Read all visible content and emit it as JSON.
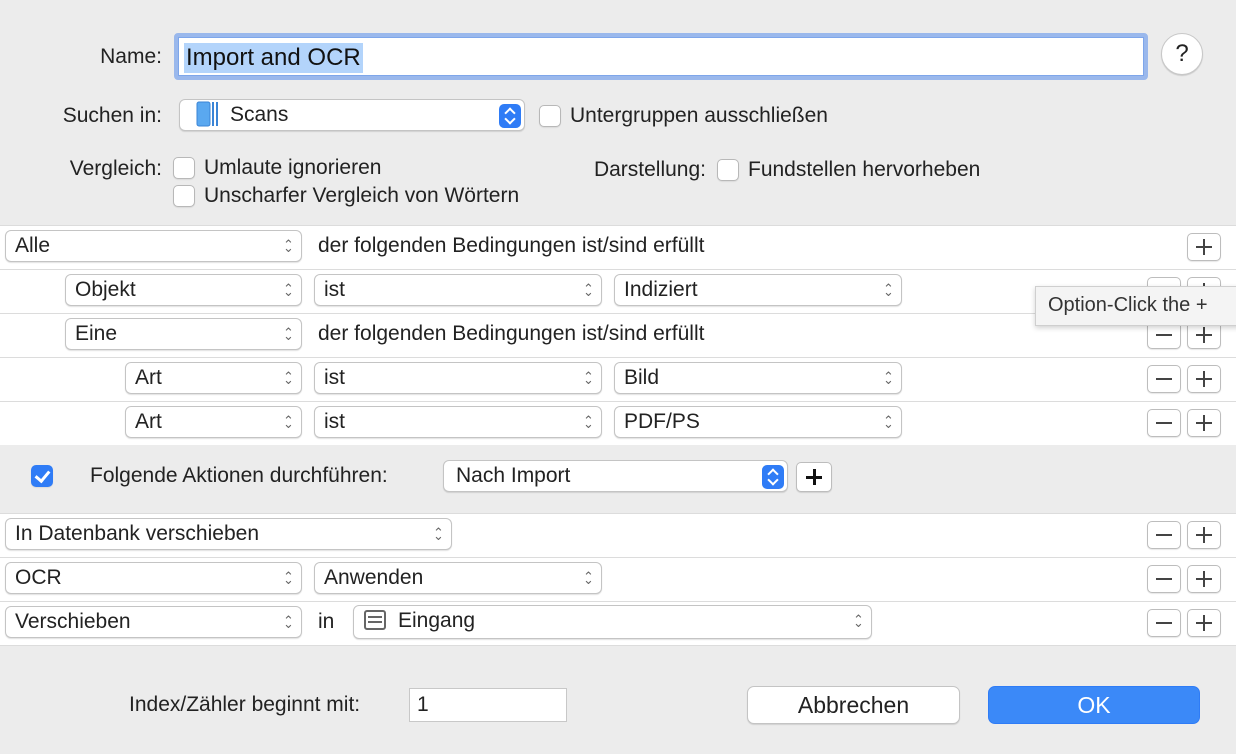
{
  "name": {
    "label": "Name:",
    "value": "Import and OCR",
    "help": "?"
  },
  "search_in": {
    "label": "Suchen in:",
    "value": "Scans",
    "exclude_label": "Untergruppen ausschließen",
    "exclude_checked": false
  },
  "compare": {
    "label": "Vergleich:",
    "option1": "Umlaute ignorieren",
    "option2": "Unscharfer Vergleich von Wörtern"
  },
  "display": {
    "label": "Darstellung:",
    "option": "Fundstellen hervorheben"
  },
  "conditions": {
    "row0": {
      "scope": "Alle",
      "text": "der folgenden Bedingungen ist/sind erfüllt"
    },
    "row1": {
      "field": "Objekt",
      "op": "ist",
      "value": "Indiziert"
    },
    "row2": {
      "scope": "Eine",
      "text": "der folgenden Bedingungen ist/sind erfüllt"
    },
    "row3": {
      "field": "Art",
      "op": "ist",
      "value": "Bild"
    },
    "row4": {
      "field": "Art",
      "op": "ist",
      "value": "PDF/PS"
    }
  },
  "tooltip": "Option-Click the +",
  "actions": {
    "enabled": true,
    "label": "Folgende Aktionen durchführen:",
    "trigger": "Nach Import",
    "row1": {
      "action": "In Datenbank verschieben"
    },
    "row2": {
      "action": "OCR",
      "mode": "Anwenden"
    },
    "row3": {
      "action": "Verschieben",
      "in": "in",
      "target": "Eingang"
    }
  },
  "index": {
    "label": "Index/Zähler beginnt mit:",
    "value": "1"
  },
  "buttons": {
    "cancel": "Abbrechen",
    "ok": "OK"
  }
}
